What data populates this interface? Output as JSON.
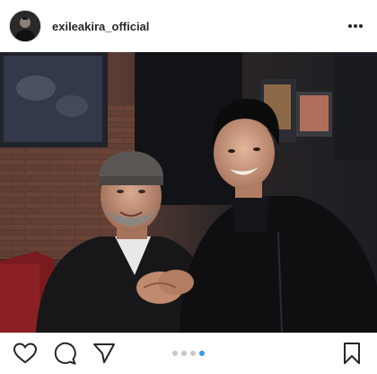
{
  "post": {
    "username": "exileakira_official",
    "carousel": {
      "total": 4,
      "active_index": 3
    }
  },
  "icons": {
    "more": "more-options-icon",
    "like": "heart-icon",
    "comment": "comment-icon",
    "share": "send-icon",
    "save": "bookmark-icon"
  },
  "colors": {
    "accent": "#3897f0",
    "text": "#262626",
    "dot_inactive": "#c7c7c7"
  }
}
